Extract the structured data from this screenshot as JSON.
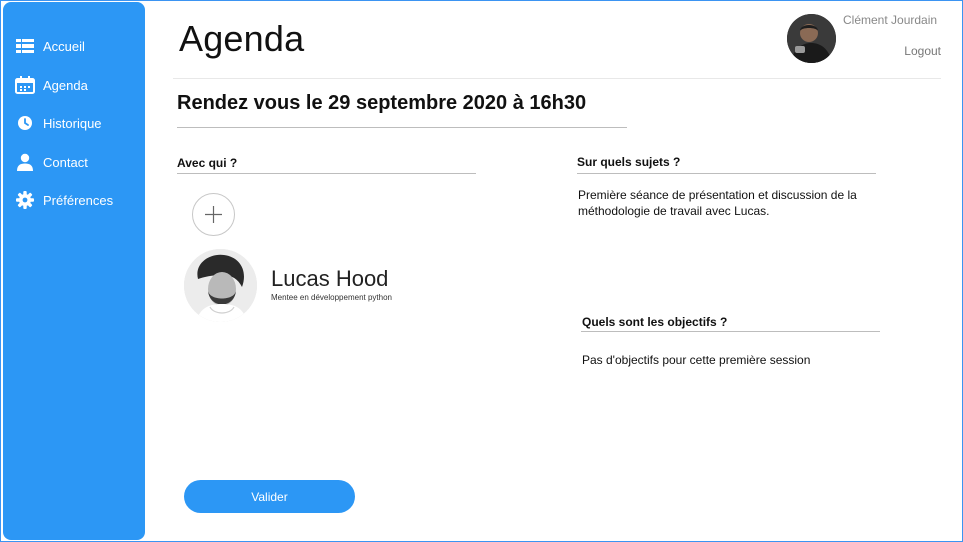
{
  "sidebar": {
    "items": [
      {
        "label": "Accueil",
        "icon": "dashboard-icon"
      },
      {
        "label": "Agenda",
        "icon": "calendar-icon"
      },
      {
        "label": "Historique",
        "icon": "clock-icon"
      },
      {
        "label": "Contact",
        "icon": "person-icon"
      },
      {
        "label": "Préférences",
        "icon": "gear-icon"
      }
    ]
  },
  "header": {
    "title": "Agenda",
    "user_name": "Clément Jourdain",
    "logout_label": "Logout"
  },
  "appointment": {
    "title": "Rendez vous le 29 septembre 2020 à 16h30"
  },
  "with_whom": {
    "label": "Avec qui ?",
    "contact": {
      "name": "Lucas Hood",
      "role": "Mentee en développement python"
    }
  },
  "subjects": {
    "label": "Sur quels sujets ?",
    "text": "Première séance de présentation et discussion de la méthodologie de travail avec Lucas."
  },
  "objectives": {
    "label": "Quels sont les objectifs ?",
    "text": "Pas d'objectifs pour cette première session"
  },
  "actions": {
    "validate_label": "Valider"
  },
  "colors": {
    "accent": "#2c97f5",
    "frame_border": "#3b94f2"
  }
}
